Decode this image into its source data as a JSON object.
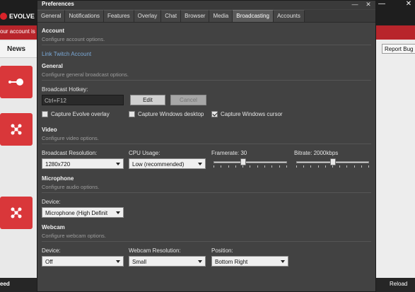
{
  "background": {
    "app_name": "EVOLVE",
    "notice_text": "our account is",
    "news_label": "News",
    "report_bug_label": "Report Bug",
    "feed_label": "eed",
    "reload_label": "Reload",
    "accent_color": "#d9373a"
  },
  "dialog": {
    "title": "Preferences",
    "minimize_glyph": "—",
    "close_glyph": "✕",
    "tabs": [
      {
        "label": "General"
      },
      {
        "label": "Notifications"
      },
      {
        "label": "Features"
      },
      {
        "label": "Overlay"
      },
      {
        "label": "Chat"
      },
      {
        "label": "Browser"
      },
      {
        "label": "Media"
      },
      {
        "label": "Broadcasting"
      },
      {
        "label": "Accounts"
      }
    ],
    "active_tab": "Broadcasting"
  },
  "account": {
    "title": "Account",
    "description": "Configure account options.",
    "link_label": "Link Twitch Account"
  },
  "general": {
    "title": "General",
    "description": "Configure general broadcast options.",
    "hotkey_label": "Broadcast Hotkey:",
    "hotkey_value": "Ctrl+F12",
    "edit_label": "Edit",
    "cancel_label": "Cancel",
    "checkboxes": [
      {
        "label": "Capture Evolve overlay",
        "checked": false
      },
      {
        "label": "Capture Windows desktop",
        "checked": false
      },
      {
        "label": "Capture Windows cursor",
        "checked": true
      }
    ]
  },
  "video": {
    "title": "Video",
    "description": "Configure video options.",
    "resolution_label": "Broadcast Resolution:",
    "resolution_value": "1280x720",
    "cpu_label": "CPU Usage:",
    "cpu_value": "Low (recommended)",
    "framerate_label": "Framerate: 30",
    "framerate_level": 0.4,
    "bitrate_label": "Bitrate: 2000kbps",
    "bitrate_level": 0.5
  },
  "microphone": {
    "title": "Microphone",
    "description": "Configure audio options.",
    "device_label": "Device:",
    "device_value": "Microphone (High Definit"
  },
  "webcam": {
    "title": "Webcam",
    "description": "Configure webcam options.",
    "device_label": "Device:",
    "device_value": "Off",
    "resolution_label": "Webcam Resolution:",
    "resolution_value": "Small",
    "position_label": "Position:",
    "position_value": "Bottom Right"
  }
}
